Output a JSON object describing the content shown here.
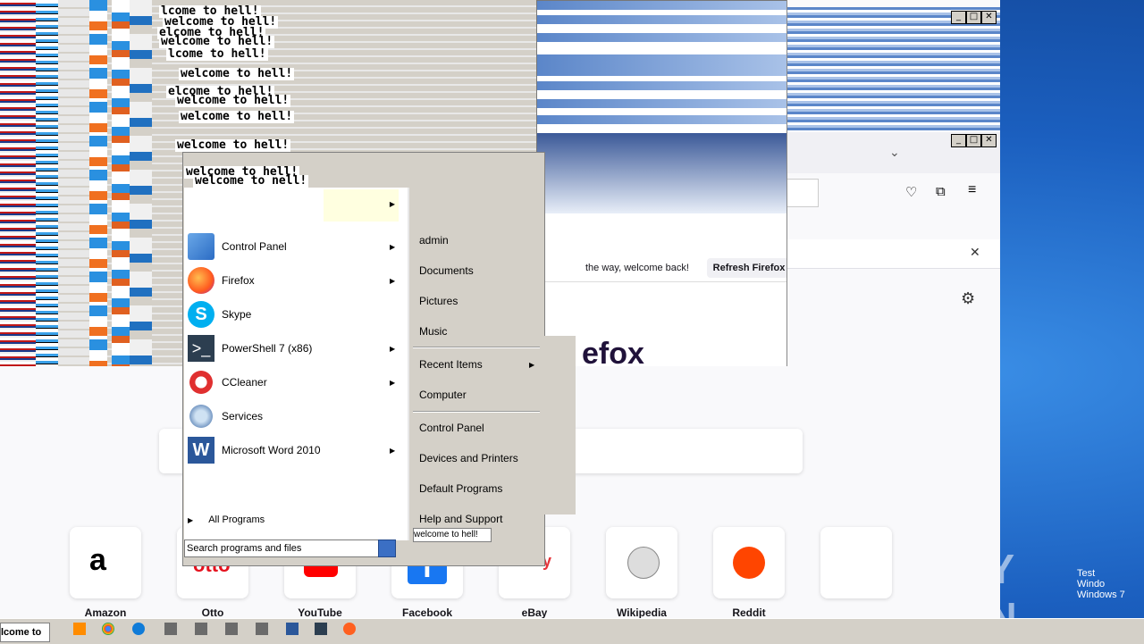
{
  "glitch": {
    "messages": [
      "welcome to hell!",
      "lcome to hell!",
      "welcome to hell!",
      "elcome to hell!",
      "welcome to hell!",
      "welcome to hell!",
      "welcome to hell!",
      "welcome to hell!"
    ]
  },
  "firefox": {
    "notification_text": "the way, welcome back!",
    "refresh_button": "Refresh Firefox",
    "brand_fragment": "efox",
    "close_icon": "close-icon",
    "settings_icon": "gear-icon",
    "shortcuts": [
      {
        "label": "Amazon",
        "icon": "amazon-icon"
      },
      {
        "label": "Otto",
        "icon": "otto-icon"
      },
      {
        "label": "YouTube",
        "icon": "youtube-icon"
      },
      {
        "label": "Facebook",
        "icon": "facebook-icon"
      },
      {
        "label": "eBay",
        "icon": "ebay-icon"
      },
      {
        "label": "Wikipedia",
        "icon": "wikipedia-icon"
      },
      {
        "label": "Reddit",
        "icon": "reddit-icon"
      }
    ]
  },
  "start_menu": {
    "title1": "welcome to hell!",
    "title2": "welcome to nell!",
    "programs": [
      {
        "label": "Control Panel",
        "submenu": true,
        "icon": "control-panel-icon"
      },
      {
        "label": "Firefox",
        "submenu": true,
        "icon": "firefox-icon"
      },
      {
        "label": "Skype",
        "submenu": false,
        "icon": "skype-icon"
      },
      {
        "label": "PowerShell 7 (x86)",
        "submenu": true,
        "icon": "powershell-icon"
      },
      {
        "label": "CCleaner",
        "submenu": true,
        "icon": "ccleaner-icon"
      },
      {
        "label": "Services",
        "submenu": false,
        "icon": "services-icon"
      },
      {
        "label": "Microsoft Word 2010",
        "submenu": true,
        "icon": "word-icon"
      }
    ],
    "all_programs": "All Programs",
    "search_placeholder": "Search programs and files",
    "right_items": [
      "admin",
      "Documents",
      "Pictures",
      "Music",
      "Recent Items",
      "Computer",
      "Control Panel",
      "Devices and Printers",
      "Default Programs",
      "Help and Support"
    ],
    "shutdown_label": "welcome to hell!"
  },
  "taskbar": {
    "task_label": "lcome to"
  },
  "watermark": {
    "text": "ANY RUN",
    "corner_lines": [
      "Test",
      "Windo",
      "Windows 7"
    ]
  },
  "colors": {
    "desktop": "#1b5fbf",
    "menu_gray": "#d4d0c8",
    "firefox_page": "#f9f9fb"
  }
}
